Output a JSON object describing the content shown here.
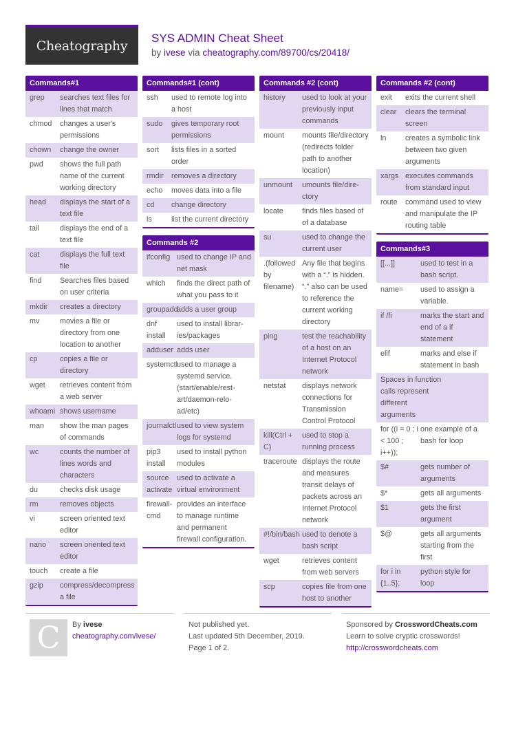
{
  "brand": {
    "logo_text": "Cheatography",
    "accent_color": "#5a0f9e"
  },
  "header": {
    "title": "SYS ADMIN Cheat Sheet",
    "by_prefix": "by",
    "author": "ivese",
    "via": "via",
    "url": "cheatography.com/89700/cs/20418/"
  },
  "blocks": {
    "commands1": {
      "title": "Commands#1",
      "rows": [
        {
          "cmd": "grep",
          "desc": "searches text files for lines that match"
        },
        {
          "cmd": "chmod",
          "desc": "changes a user's permissions"
        },
        {
          "cmd": "chown",
          "desc": "change the owner"
        },
        {
          "cmd": "pwd",
          "desc": "shows the full path name of the current working directory"
        },
        {
          "cmd": "head",
          "desc": "displays the start of a text file"
        },
        {
          "cmd": "tail",
          "desc": "displays the end of a text file"
        },
        {
          "cmd": "cat",
          "desc": "displays the full text file"
        },
        {
          "cmd": "find",
          "desc": "Searches files based on user criteria"
        },
        {
          "cmd": "mkdir",
          "desc": "creates a directory"
        },
        {
          "cmd": "mv",
          "desc": "movies a file or directory from one location to another"
        },
        {
          "cmd": "cp",
          "desc": "copies a file or directory"
        },
        {
          "cmd": "wget",
          "desc": "retrieves content from a web server"
        },
        {
          "cmd": "whoami",
          "desc": "shows username"
        },
        {
          "cmd": "man",
          "desc": "show the man pages of commands"
        },
        {
          "cmd": "wc",
          "desc": "counts the number of lines words and characters"
        },
        {
          "cmd": "du",
          "desc": "checks disk usage"
        },
        {
          "cmd": "rm",
          "desc": "removes objects"
        },
        {
          "cmd": "vi",
          "desc": "screen oriented text editor"
        },
        {
          "cmd": "nano",
          "desc": "screen oriented text editor"
        },
        {
          "cmd": "touch",
          "desc": "create a file"
        },
        {
          "cmd": "gzip",
          "desc": "compress/dec­ompress a file"
        }
      ]
    },
    "commands1_cont": {
      "title": "Commands#1 (cont)",
      "rows": [
        {
          "cmd": "ssh",
          "desc": "used to remote log into a host"
        },
        {
          "cmd": "sudo",
          "desc": "gives temporary root permissions"
        },
        {
          "cmd": "sort",
          "desc": "lists files in a sorted order"
        },
        {
          "cmd": "rmdir",
          "desc": "removes a directory"
        },
        {
          "cmd": "echo",
          "desc": "moves data into a file"
        },
        {
          "cmd": "cd",
          "desc": "change directory"
        },
        {
          "cmd": "ls",
          "desc": "list the current directory"
        }
      ]
    },
    "commands2": {
      "title": "Commands #2",
      "rows": [
        {
          "cmd": "ifconfig",
          "desc": "used to change IP and net mask"
        },
        {
          "cmd": "which",
          "desc": "finds the direct path of what you pass to it"
        },
        {
          "cmd": "groupadd",
          "desc": "adds a user group"
        },
        {
          "cmd": "dnf install",
          "desc": "used to install librar­ies/packages"
        },
        {
          "cmd": "adduser",
          "desc": "adds user"
        },
        {
          "cmd": "systemctl",
          "desc": "used to manage a systemd service. (start/enable/rest­art/daemon-relo­ad/etc)"
        },
        {
          "cmd": "journalctl",
          "desc": "used to view system logs for systemd"
        },
        {
          "cmd": "pip3 install",
          "desc": "used to install python modules"
        },
        {
          "cmd": "source activate",
          "desc": "used to activate a virtual environment"
        },
        {
          "cmd": "firewall-cmd",
          "desc": "provides an interface to manage runtime and permanent firewall configuration."
        }
      ]
    },
    "commands2_cont_a": {
      "title": "Commands #2 (cont)",
      "rows": [
        {
          "cmd": "history",
          "desc": "used to look at your previously input commands"
        },
        {
          "cmd": "mount",
          "desc": "mounts file/dire­ctory (redirects folder path to another location)"
        },
        {
          "cmd": "unmount",
          "desc": "umounts file/dire­ctory"
        },
        {
          "cmd": "locate",
          "desc": "finds files based of of a database"
        },
        {
          "cmd": "su",
          "desc": "used to change the current user"
        },
        {
          "cmd": ".(followed by filename)",
          "desc": "Any file that begins with a “.” is hidden. “.” also can be used to reference the current working directory"
        },
        {
          "cmd": "ping",
          "desc": "test the reachability of a host on an Internet Protocol network"
        },
        {
          "cmd": "netstat",
          "desc": "displays network connections for Transmission Control Protocol"
        },
        {
          "cmd": "kill(Ctrl + C)",
          "desc": "used to stop a running process"
        },
        {
          "cmd": "traceroute",
          "desc": "displays the route and measures transit delays of packets across an Internet Protocol network"
        },
        {
          "cmd": "#!/bin/bash",
          "desc": "used to denote a bash script"
        },
        {
          "cmd": "wget",
          "desc": "retrieves content from web servers"
        },
        {
          "cmd": "scp",
          "desc": "copies file from one host to another"
        }
      ]
    },
    "commands2_cont_b": {
      "title": "Commands #2 (cont)",
      "rows": [
        {
          "cmd": "exit",
          "desc": "exits the current shell"
        },
        {
          "cmd": "clear",
          "desc": "clears the terminal screen"
        },
        {
          "cmd": "ln",
          "desc": "creates a symbolic link between two given arguments"
        },
        {
          "cmd": "xargs",
          "desc": "executes commands from standard input"
        },
        {
          "cmd": "route",
          "desc": "command used to view and manipulate the IP routing table"
        }
      ]
    },
    "commands3": {
      "title": "Commands#3",
      "rows": [
        {
          "cmd": "[[...]]",
          "desc": "used to test in a bash script."
        },
        {
          "cmd": "name=",
          "desc": "used to assign a variable."
        },
        {
          "cmd": "if /fi",
          "desc": "marks the start and end of a if statement"
        },
        {
          "cmd": "elif",
          "desc": "marks and else if statement in bash"
        },
        {
          "cmd": "",
          "desc": "Spaces in function calls represent different arguments",
          "full": true
        },
        {
          "cmd": "for ((i = 0 ; i < 100 ; i++));",
          "desc": "one example of a bash for loop"
        },
        {
          "cmd": "$#",
          "desc": "gets number of arguments"
        },
        {
          "cmd": "$*",
          "desc": "gets all arguments"
        },
        {
          "cmd": "$1",
          "desc": "gets the first argument"
        },
        {
          "cmd": "$@",
          "desc": "gets all arguments starting from the first"
        },
        {
          "cmd": "for i in {1..5};",
          "desc": "python style for loop"
        }
      ]
    }
  },
  "footer": {
    "avatar_letter": "C",
    "by_label": "By",
    "author": "ivese",
    "author_url": "cheatography.com/ivese/",
    "status": "Not published yet.",
    "updated": "Last updated 5th December, 2019.",
    "page": "Page 1 of 2.",
    "sponsor_prefix": "Sponsored by",
    "sponsor_name": "CrosswordCheats.com",
    "sponsor_tagline": "Learn to solve cryptic crosswords!",
    "sponsor_url": "http://crosswordcheats.com"
  }
}
